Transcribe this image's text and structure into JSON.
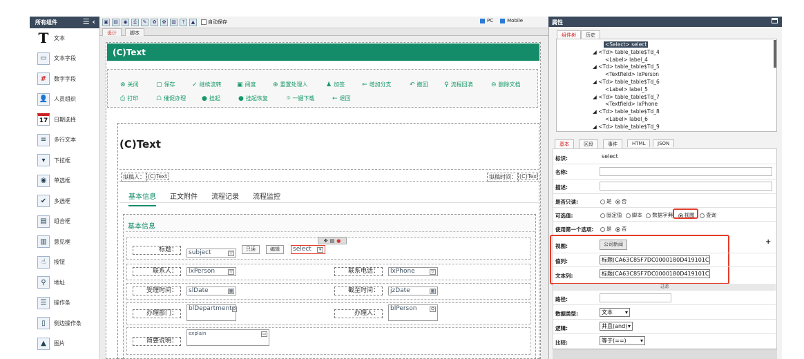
{
  "palette": {
    "title": "所有组件",
    "items": [
      {
        "label": "文本",
        "icon": "T"
      },
      {
        "label": "文本字段",
        "icon": "▭"
      },
      {
        "label": "数字字段",
        "icon": "#"
      },
      {
        "label": "人员组织",
        "icon": "👤"
      },
      {
        "label": "日期选择",
        "icon": "17"
      },
      {
        "label": "多行文本",
        "icon": "≡"
      },
      {
        "label": "下拉框",
        "icon": "▾"
      },
      {
        "label": "单选框",
        "icon": "◉"
      },
      {
        "label": "多选框",
        "icon": "✔"
      },
      {
        "label": "组合框",
        "icon": "▤"
      },
      {
        "label": "意见框",
        "icon": "▥"
      },
      {
        "label": "按钮",
        "icon": "☝"
      },
      {
        "label": "地址",
        "icon": "⚲"
      },
      {
        "label": "操作条",
        "icon": "☰"
      },
      {
        "label": "侧边操作条",
        "icon": "▯"
      },
      {
        "label": "图片",
        "icon": "▲"
      }
    ]
  },
  "toolbar": {
    "autosave_label": "自动保存",
    "pc_label": "PC",
    "mobile_label": "Mobile"
  },
  "editor_tabs": [
    "设计",
    "脚本"
  ],
  "form": {
    "header_title": "(C)Text",
    "actions_row1": [
      "关闭",
      "保存",
      "继续流转",
      "阅度",
      "重置处理人",
      "加签",
      "增加分支",
      "撤回",
      "流程回滴",
      "删除文档"
    ],
    "actions_row2": [
      "打印",
      "催促办理",
      "挂起",
      "挂起恢复",
      "一键下载",
      "退回"
    ],
    "title": "(C)Text",
    "drafter_label": "拟稿人：",
    "drafter_value": "(C)Text",
    "draft_time_label": "拟稿时间：",
    "draft_time_value": "(C)Text",
    "tabs": [
      "基本信息",
      "正文附件",
      "流程记录",
      "流程监控"
    ],
    "section_title": "基本信息",
    "fields": {
      "title_label": "标题：",
      "subject": "subject",
      "readonly_btn": "只读",
      "edit_btn": "编辑",
      "select": "select",
      "contact_label": "联系人：",
      "contact_value": "lxPerson",
      "phone_label": "联系电话：",
      "phone_value": "lxPhone",
      "accept_time_label": "受理时间：",
      "accept_time_value": "slDate",
      "deadline_label": "截至时间：",
      "deadline_value": "jzDate",
      "dept_label": "办理部门：",
      "dept_value": "blDepartment",
      "handler_label": "办理人：",
      "handler_value": "blPerson",
      "summary_label": "简要说明：",
      "summary_value": "explain"
    }
  },
  "right_panel": {
    "title": "属性",
    "top_tabs": [
      "组件树",
      "历史"
    ],
    "tree": [
      {
        "text": "<Select> select",
        "selected": true
      },
      {
        "text": "◢ <Td> table_table$Td_4"
      },
      {
        "text": "<Label> label_4"
      },
      {
        "text": "◢ <Td> table_table$Td_5"
      },
      {
        "text": "<Textfield> lxPerson"
      },
      {
        "text": "◢ <Td> table_table$Td_6"
      },
      {
        "text": "<Label> label_5"
      },
      {
        "text": "◢ <Td> table_table$Td_7"
      },
      {
        "text": "<Textfield> lxPhone"
      },
      {
        "text": "◢ <Td> table_table$Td_8"
      },
      {
        "text": "<Label> label_6"
      },
      {
        "text": "◢ <Td> table_table$Td_9"
      }
    ],
    "prop_tabs": [
      "基本",
      "区段",
      "事件",
      "HTML",
      "JSON"
    ],
    "props": {
      "id_label": "标识:",
      "id_value": "select",
      "name_label": "名称:",
      "desc_label": "描述:",
      "readonly_label": "是否只读:",
      "yes": "是",
      "no": "否",
      "options_label": "可选值:",
      "option_fixed": "固定值",
      "option_script": "脚本",
      "option_dict": "数据字典",
      "option_view": "视图",
      "option_query": "查询",
      "use_first_label": "使用第一个选项:",
      "view_label": "视图:",
      "view_value": "公司新闻",
      "value_col_label": "值列:",
      "value_col_value": "标题(CA63C85F7DC0000180D419101C9C",
      "text_col_label": "文本列:",
      "text_col_value": "标题(CA63C85F7DC0000180D419101C9C",
      "filter_label": "过滤",
      "path_label": "路径:",
      "datatype_label": "数据类型:",
      "datatype_value": "文本",
      "logic_label": "逻辑:",
      "logic_value": "并且(and)",
      "compare_label": "比较:",
      "compare_value": "等于(==)",
      "plus": "+"
    }
  }
}
